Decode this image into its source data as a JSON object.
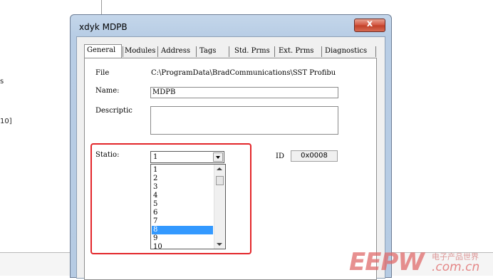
{
  "background": {
    "left_texts": [
      "s",
      "10]"
    ]
  },
  "window": {
    "title": "xdyk MDPB",
    "close_label": "x",
    "tabs": [
      "General",
      "Modules",
      "Address",
      "Tags",
      "Std. Prms",
      "Ext. Prms",
      "Diagnostics"
    ],
    "active_tab": "General"
  },
  "general": {
    "file_label": "File",
    "file_value": "C:\\ProgramData\\BradCommunications\\SST Profibu",
    "name_label": "Name:",
    "name_value": "MDPB",
    "description_label": "Descriptic",
    "description_value": "",
    "station_label": "Statio:",
    "station_selected": "1",
    "id_label": "ID",
    "id_value": "0x0008"
  },
  "station_dropdown": {
    "options": [
      "1",
      "2",
      "3",
      "4",
      "5",
      "6",
      "7",
      "8",
      "9",
      "10"
    ],
    "highlighted": "8"
  },
  "watermark": {
    "logo": "EEPW",
    "cn_text": "电子产品世界",
    "url": ".com.cn"
  },
  "colors": {
    "highlight_border": "#e3262a",
    "selection": "#3399ff",
    "close_button": "#c13f28"
  }
}
